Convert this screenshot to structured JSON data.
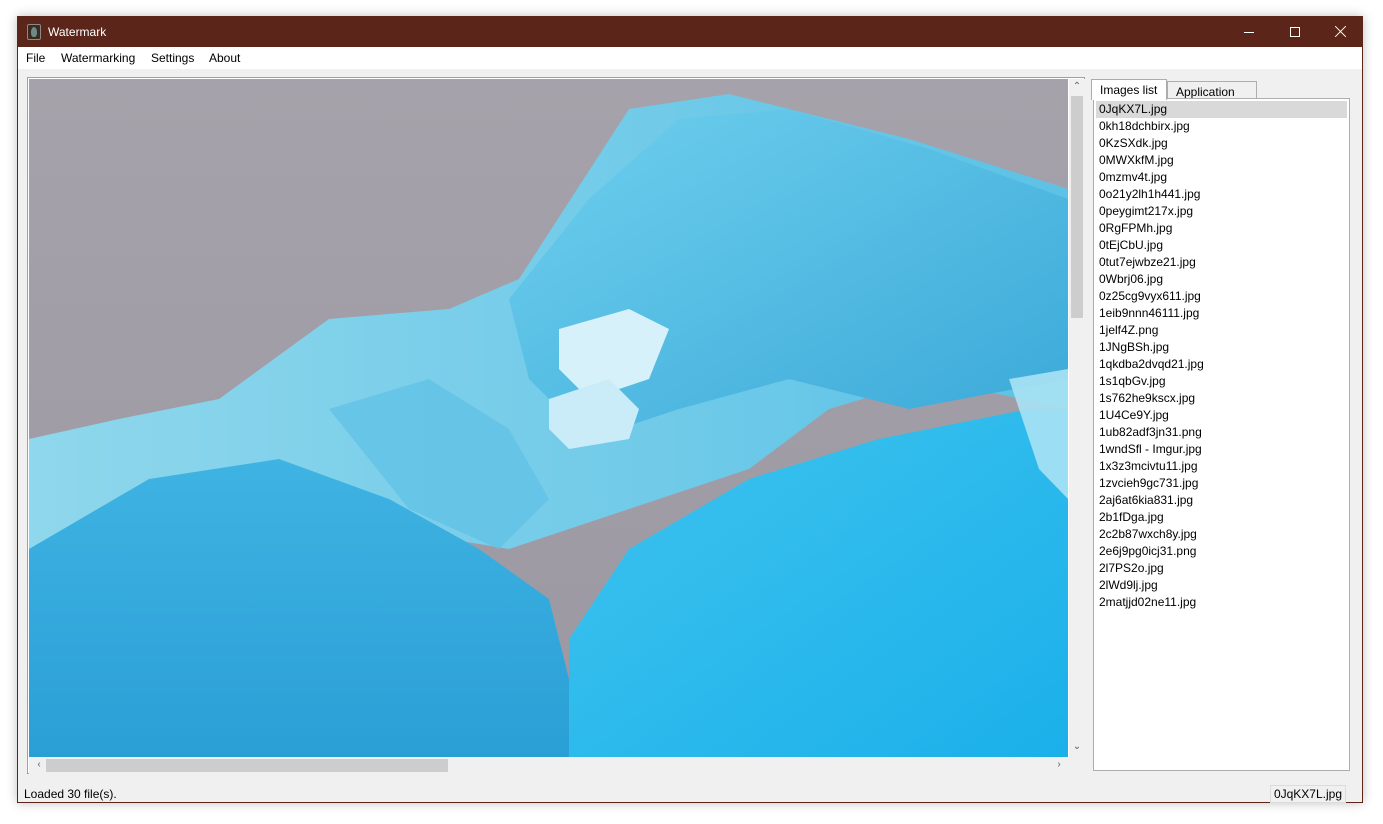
{
  "window": {
    "title": "Watermark"
  },
  "menu": [
    "File",
    "Watermarking",
    "Settings",
    "About"
  ],
  "tabs": [
    {
      "label": "Images list",
      "active": true
    },
    {
      "label": "Application log",
      "active": false
    }
  ],
  "files": [
    "0JqKX7L.jpg",
    "0kh18dchbirx.jpg",
    "0KzSXdk.jpg",
    "0MWXkfM.jpg",
    "0mzmv4t.jpg",
    "0o21y2lh1h441.jpg",
    "0peygimt217x.jpg",
    "0RgFPMh.jpg",
    "0tEjCbU.jpg",
    "0tut7ejwbze21.jpg",
    "0Wbrj06.jpg",
    "0z25cg9vyx611.jpg",
    "1eib9nnn46111.jpg",
    "1jelf4Z.png",
    "1JNgBSh.jpg",
    "1qkdba2dvqd21.jpg",
    "1s1qbGv.jpg",
    "1s762he9kscx.jpg",
    "1U4Ce9Y.jpg",
    "1ub82adf3jn31.png",
    "1wndSfl - Imgur.jpg",
    "1x3z3mcivtu11.jpg",
    "1zvcieh9gc731.jpg",
    "2aj6at6kia831.jpg",
    "2b1fDga.jpg",
    "2c2b87wxch8y.jpg",
    "2e6j9pg0icj31.png",
    "2l7PS2o.jpg",
    "2lWd9lj.jpg",
    "2matjjd02ne11.jpg"
  ],
  "selected_index": 0,
  "status": {
    "message": "Loaded 30 file(s).",
    "current_file": "0JqKX7L.jpg"
  },
  "colors": {
    "titlebar": "#5b2619",
    "selection": "#d9d9d9"
  }
}
